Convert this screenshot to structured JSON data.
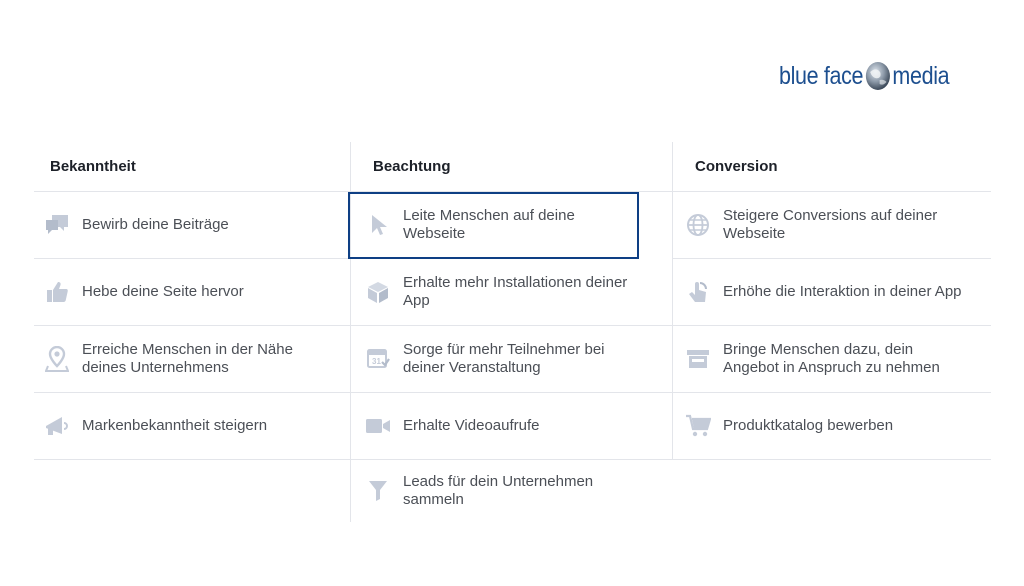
{
  "brand": {
    "part1": "blue face",
    "part2": "media"
  },
  "columns": [
    {
      "heading": "Bekanntheit",
      "items": [
        {
          "label": "Bewirb deine Beiträge",
          "icon": "chat-bubbles-icon"
        },
        {
          "label": "Hebe deine Seite hervor",
          "icon": "thumbs-up-icon"
        },
        {
          "label": "Erreiche Menschen in der Nähe deines Unternehmens",
          "icon": "location-pin-icon"
        },
        {
          "label": "Markenbekanntheit steigern",
          "icon": "megaphone-icon"
        }
      ]
    },
    {
      "heading": "Beachtung",
      "items": [
        {
          "label": "Leite Menschen auf deine Webseite",
          "icon": "cursor-icon",
          "selected": true
        },
        {
          "label": "Erhalte mehr Installationen deiner App",
          "icon": "box-icon"
        },
        {
          "label": "Sorge für mehr Teilnehmer bei deiner Veranstaltung",
          "icon": "calendar-icon"
        },
        {
          "label": "Erhalte Videoaufrufe",
          "icon": "video-camera-icon"
        },
        {
          "label": "Leads für dein Unternehmen sammeln",
          "icon": "funnel-icon"
        }
      ]
    },
    {
      "heading": "Conversion",
      "items": [
        {
          "label": "Steigere Conversions auf deiner Webseite",
          "icon": "globe-icon"
        },
        {
          "label": "Erhöhe die Interaktion in deiner App",
          "icon": "touch-icon"
        },
        {
          "label": "Bringe Menschen dazu, dein Angebot in Anspruch zu nehmen",
          "icon": "storefront-icon"
        },
        {
          "label": "Produktkatalog bewerben",
          "icon": "shopping-cart-icon"
        }
      ]
    }
  ],
  "colors": {
    "brand": "#1d4f8f",
    "icon": "#c4cbd8",
    "selected_border": "#0e3f84",
    "label": "#4b4f56",
    "heading": "#1d2129"
  }
}
